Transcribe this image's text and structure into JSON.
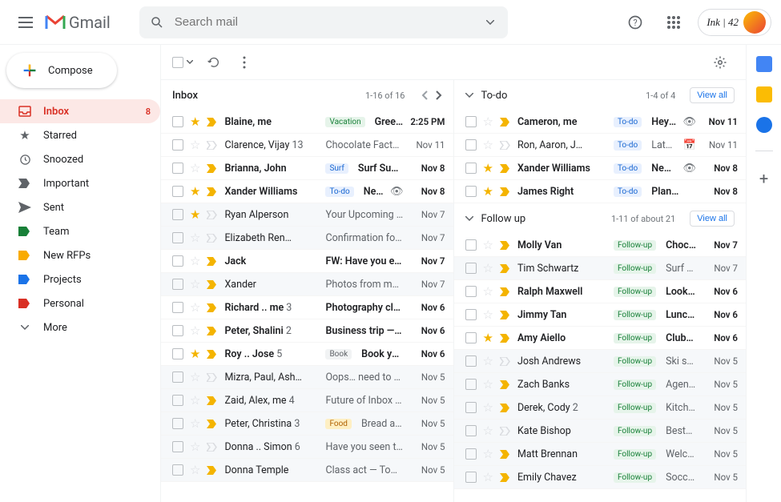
{
  "header": {
    "product": "Gmail",
    "search_placeholder": "Search mail",
    "account": "Ink | 42"
  },
  "sidebar": {
    "compose": "Compose",
    "items": [
      {
        "icon": "inbox",
        "label": "Inbox",
        "badge": "8",
        "active": true
      },
      {
        "icon": "star",
        "label": "Starred"
      },
      {
        "icon": "clock",
        "label": "Snoozed"
      },
      {
        "icon": "important",
        "label": "Important"
      },
      {
        "icon": "send",
        "label": "Sent"
      },
      {
        "icon": "tag-green",
        "label": "Team"
      },
      {
        "icon": "tag-yellow",
        "label": "New RFPs"
      },
      {
        "icon": "tag-blue",
        "label": "Projects"
      },
      {
        "icon": "tag-red",
        "label": "Personal"
      },
      {
        "icon": "more",
        "label": "More"
      }
    ]
  },
  "sections": {
    "inbox": {
      "title": "Inbox",
      "count": "1-16 of 16",
      "rows": [
        {
          "unread": true,
          "star": true,
          "imp": true,
          "sender": "Blaine, me",
          "tag": {
            "text": "Vacation",
            "bg": "#e6f4ea",
            "fg": "#188038"
          },
          "subject": "Greece…",
          "date": "2:25 PM"
        },
        {
          "unread": false,
          "star": false,
          "imp": false,
          "sender": "Clarence, Vijay",
          "count": "13",
          "subject": "Chocolate Factor…",
          "date": "Nov 11"
        },
        {
          "unread": true,
          "star": false,
          "imp": true,
          "sender": "Brianna, John",
          "tag": {
            "text": "Surf",
            "bg": "#e8f0fe",
            "fg": "#1967d2"
          },
          "subject": "Surf Sunda…",
          "date": "Nov 8"
        },
        {
          "unread": true,
          "star": true,
          "imp": true,
          "sender": "Xander Williams",
          "tag": {
            "text": "To-do",
            "bg": "#e8f0fe",
            "fg": "#1967d2"
          },
          "subject": "Need…",
          "attach": true,
          "date": "Nov 8"
        },
        {
          "unread": false,
          "shaded": true,
          "star": true,
          "imp": false,
          "sender": "Ryan Alperson",
          "subject": "Your Upcoming R…",
          "date": "Nov 7"
        },
        {
          "unread": false,
          "shaded": true,
          "star": false,
          "imp": false,
          "sender": "Elizabeth Ren…",
          "subject": "Confirmation for…",
          "date": "Nov 7"
        },
        {
          "unread": true,
          "star": false,
          "imp": true,
          "sender": "Jack",
          "subject": "FW: Have you ev…",
          "date": "Nov 7"
        },
        {
          "unread": false,
          "shaded": true,
          "star": false,
          "imp": true,
          "sender": "Xander",
          "subject": "Photos from my r…",
          "date": "Nov 7"
        },
        {
          "unread": true,
          "star": false,
          "imp": true,
          "sender": "Richard .. me",
          "count": "3",
          "subject": "Photography clas…",
          "date": "Nov 6"
        },
        {
          "unread": true,
          "star": false,
          "imp": true,
          "sender": "Peter, Shalini",
          "count": "2",
          "subject": "Business trip — H…",
          "date": "Nov 6"
        },
        {
          "unread": true,
          "star": true,
          "imp": true,
          "sender": "Roy .. Jose",
          "count": "5",
          "tag": {
            "text": "Book",
            "bg": "#f1f3f4",
            "fg": "#5f6368"
          },
          "subject": "Book you r…",
          "date": "Nov 6"
        },
        {
          "unread": false,
          "shaded": true,
          "star": false,
          "imp": false,
          "sender": "Mizra, Paul, Ash…",
          "subject": "Oops… need to re…",
          "date": "Nov 5"
        },
        {
          "unread": false,
          "shaded": true,
          "star": false,
          "imp": true,
          "sender": "Zaid, Alex, me",
          "count": "4",
          "subject": "Future of Inbox — …",
          "date": "Nov 5"
        },
        {
          "unread": false,
          "shaded": true,
          "star": false,
          "imp": true,
          "sender": "Peter, Christina",
          "count": "3",
          "tag": {
            "text": "Food",
            "bg": "#feefc3",
            "fg": "#b06000"
          },
          "subject": "Bread and…",
          "date": "Nov 5"
        },
        {
          "unread": false,
          "shaded": true,
          "star": false,
          "imp": false,
          "sender": "Donna .. Simon",
          "count": "6",
          "subject": "Have you seen th…",
          "date": "Nov 5"
        },
        {
          "unread": false,
          "shaded": true,
          "star": false,
          "imp": true,
          "sender": "Donna Temple",
          "subject": "Class act — Tom…",
          "date": "Nov 5"
        }
      ]
    },
    "todo": {
      "title": "To-do",
      "count": "1-4 of 4",
      "viewall": "View all",
      "rows": [
        {
          "unread": true,
          "star": false,
          "imp": true,
          "sender": "Cameron, me",
          "tag": {
            "text": "To-do",
            "bg": "#e8f0fe",
            "fg": "#1967d2"
          },
          "subject": "Hey t…",
          "attach": true,
          "date": "Nov 11"
        },
        {
          "unread": false,
          "star": false,
          "imp": false,
          "sender": "Ron, Aaron, J…",
          "tag": {
            "text": "To-do",
            "bg": "#e8f0fe",
            "fg": "#1967d2"
          },
          "subject": "Late…",
          "cal": true,
          "date": "Nov 11"
        },
        {
          "unread": true,
          "star": true,
          "imp": true,
          "sender": "Xander Williams",
          "tag": {
            "text": "To-do",
            "bg": "#e8f0fe",
            "fg": "#1967d2"
          },
          "subject": "Need…",
          "attach": true,
          "date": "Nov 8"
        },
        {
          "unread": true,
          "star": true,
          "imp": true,
          "sender": "James Right",
          "tag": {
            "text": "To-do",
            "bg": "#e8f0fe",
            "fg": "#1967d2"
          },
          "subject": "Plan…",
          "date": "Nov 8"
        }
      ]
    },
    "followup": {
      "title": "Follow up",
      "count": "1-11 of about 21",
      "viewall": "View all",
      "rows": [
        {
          "unread": true,
          "star": false,
          "imp": true,
          "sender": "Molly Van",
          "tag": {
            "text": "Follow-up",
            "bg": "#e6f4ea",
            "fg": "#188038"
          },
          "subject": "Choco…",
          "date": "Nov 7"
        },
        {
          "unread": false,
          "shaded": true,
          "star": false,
          "imp": true,
          "sender": "Tim Schwartz",
          "tag": {
            "text": "Follow-up",
            "bg": "#e6f4ea",
            "fg": "#188038"
          },
          "subject": "Surf S…",
          "date": "Nov 7"
        },
        {
          "unread": true,
          "star": false,
          "imp": true,
          "sender": "Ralph Maxwell",
          "tag": {
            "text": "Follow-up",
            "bg": "#e6f4ea",
            "fg": "#188038"
          },
          "subject": "Looki…",
          "date": "Nov 6"
        },
        {
          "unread": true,
          "star": false,
          "imp": true,
          "sender": "Jimmy Tan",
          "tag": {
            "text": "Follow-up",
            "bg": "#e6f4ea",
            "fg": "#188038"
          },
          "subject": "Lunch…",
          "date": "Nov 6"
        },
        {
          "unread": true,
          "star": true,
          "imp": true,
          "sender": "Amy Aiello",
          "tag": {
            "text": "Follow-up",
            "bg": "#e6f4ea",
            "fg": "#188038"
          },
          "subject": "Club…",
          "date": "Nov 6"
        },
        {
          "unread": false,
          "shaded": true,
          "star": false,
          "imp": false,
          "sender": "Josh Andrews",
          "tag": {
            "text": "Follow-up",
            "bg": "#e6f4ea",
            "fg": "#188038"
          },
          "subject": "Ski se…",
          "date": "Nov 5"
        },
        {
          "unread": false,
          "shaded": true,
          "star": false,
          "imp": true,
          "sender": "Zach Banks",
          "tag": {
            "text": "Follow-up",
            "bg": "#e6f4ea",
            "fg": "#188038"
          },
          "subject": "Agend…",
          "date": "Nov 5"
        },
        {
          "unread": false,
          "shaded": true,
          "star": false,
          "imp": true,
          "sender": "Derek, Cody",
          "count": "2",
          "tag": {
            "text": "Follow-up",
            "bg": "#e6f4ea",
            "fg": "#188038"
          },
          "subject": "Kitche…",
          "date": "Nov 5"
        },
        {
          "unread": false,
          "shaded": true,
          "star": false,
          "imp": false,
          "sender": "Kate Bishop",
          "tag": {
            "text": "Follow-up",
            "bg": "#e6f4ea",
            "fg": "#188038"
          },
          "subject": "Best…",
          "date": "Nov 5"
        },
        {
          "unread": false,
          "shaded": true,
          "star": false,
          "imp": true,
          "sender": "Matt Brennan",
          "tag": {
            "text": "Follow-up",
            "bg": "#e6f4ea",
            "fg": "#188038"
          },
          "subject": "Welco…",
          "date": "Nov 5"
        },
        {
          "unread": false,
          "shaded": true,
          "star": false,
          "imp": true,
          "sender": "Emily Chavez",
          "tag": {
            "text": "Follow-up",
            "bg": "#e6f4ea",
            "fg": "#188038"
          },
          "subject": "Socce…",
          "date": "Nov 5"
        }
      ]
    }
  }
}
